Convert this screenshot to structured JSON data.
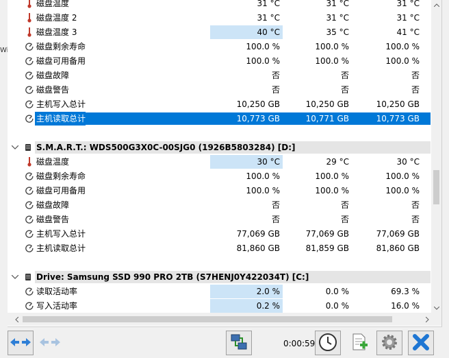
{
  "edge_text": "Wi",
  "sensor_rows_top": [
    {
      "label": "磁盘温度",
      "icon": "thermometer-icon",
      "v1": "31 °C",
      "v2": "31 °C",
      "v3": "31 °C",
      "hl": false
    },
    {
      "label": "磁盘温度 2",
      "icon": "thermometer-icon",
      "v1": "31 °C",
      "v2": "31 °C",
      "v3": "31 °C",
      "hl": false
    },
    {
      "label": "磁盘温度 3",
      "icon": "thermometer-icon",
      "v1": "40 °C",
      "v2": "35 °C",
      "v3": "41 °C",
      "hl": true
    },
    {
      "label": "磁盘剩余寿命",
      "icon": "gauge-icon",
      "v1": "100.0 %",
      "v2": "100.0 %",
      "v3": "100.0 %",
      "hl": false
    },
    {
      "label": "磁盘可用备用",
      "icon": "gauge-icon",
      "v1": "100.0 %",
      "v2": "100.0 %",
      "v3": "100.0 %",
      "hl": false
    },
    {
      "label": "磁盘故障",
      "icon": "gauge-icon",
      "v1": "否",
      "v2": "否",
      "v3": "否",
      "hl": false
    },
    {
      "label": "磁盘警告",
      "icon": "gauge-icon",
      "v1": "否",
      "v2": "否",
      "v3": "否",
      "hl": false
    },
    {
      "label": "主机写入总计",
      "icon": "gauge-icon",
      "v1": "10,250 GB",
      "v2": "10,250 GB",
      "v3": "10,250 GB",
      "hl": false
    },
    {
      "label": "主机读取总计",
      "icon": "gauge-icon",
      "v1": "10,773 GB",
      "v2": "10,771 GB",
      "v3": "10,773 GB",
      "hl": false,
      "selected": true
    }
  ],
  "group_smart": {
    "title": "S.M.A.R.T.: WDS500G3X0C-00SJG0 (1926B5803284) [D:]",
    "rows": [
      {
        "label": "磁盘温度",
        "icon": "thermometer-icon",
        "v1": "30 °C",
        "v2": "29 °C",
        "v3": "30 °C",
        "hl": true
      },
      {
        "label": "磁盘剩余寿命",
        "icon": "gauge-icon",
        "v1": "100.0 %",
        "v2": "100.0 %",
        "v3": "100.0 %",
        "hl": false
      },
      {
        "label": "磁盘可用备用",
        "icon": "gauge-icon",
        "v1": "100.0 %",
        "v2": "100.0 %",
        "v3": "100.0 %",
        "hl": false
      },
      {
        "label": "磁盘故障",
        "icon": "gauge-icon",
        "v1": "否",
        "v2": "否",
        "v3": "否",
        "hl": false
      },
      {
        "label": "磁盘警告",
        "icon": "gauge-icon",
        "v1": "否",
        "v2": "否",
        "v3": "否",
        "hl": false
      },
      {
        "label": "主机写入总计",
        "icon": "gauge-icon",
        "v1": "77,069 GB",
        "v2": "77,069 GB",
        "v3": "77,069 GB",
        "hl": false
      },
      {
        "label": "主机读取总计",
        "icon": "gauge-icon",
        "v1": "81,860 GB",
        "v2": "81,859 GB",
        "v3": "81,860 GB",
        "hl": false
      }
    ]
  },
  "group_drive": {
    "title": "Drive: Samsung SSD 990 PRO 2TB (S7HENJ0Y422034T) [C:]",
    "rows": [
      {
        "label": "读取活动率",
        "icon": "gauge-icon",
        "v1": "2.0 %",
        "v2": "0.0 %",
        "v3": "69.3 %",
        "hl": true
      },
      {
        "label": "写入活动率",
        "icon": "gauge-icon",
        "v1": "0.2 %",
        "v2": "0.0 %",
        "v3": "16.0 %",
        "hl": true
      }
    ]
  },
  "toolbar": {
    "timer": "0:00:59"
  },
  "colors": {
    "selection": "#0078d7",
    "highlight_cell": "#cce4f7",
    "thermometer": "#c0392b"
  }
}
